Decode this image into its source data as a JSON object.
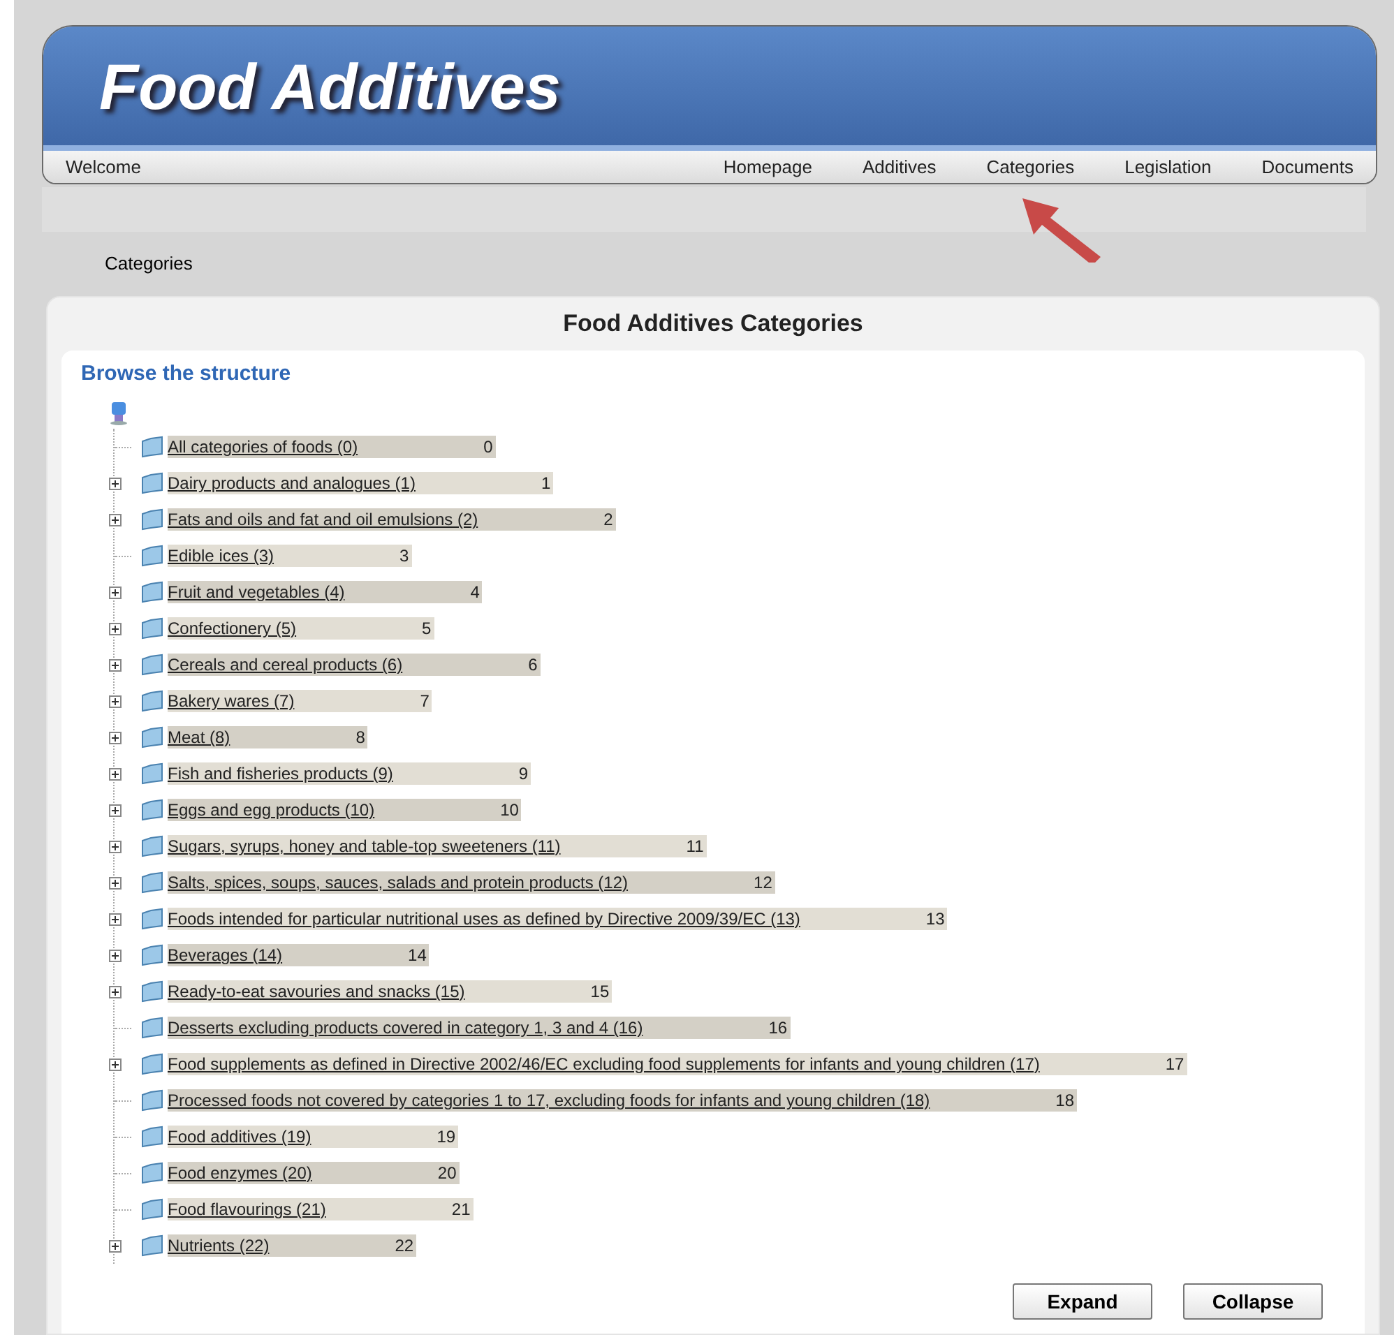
{
  "header": {
    "title": "Food Additives",
    "welcome": "Welcome",
    "nav": [
      {
        "label": "Homepage"
      },
      {
        "label": "Additives"
      },
      {
        "label": "Categories"
      },
      {
        "label": "Legislation"
      },
      {
        "label": "Documents"
      }
    ]
  },
  "breadcrumb": "Categories",
  "panel": {
    "title": "Food Additives Categories",
    "heading": "Browse the structure",
    "tree": [
      {
        "label": "All categories of foods (0)",
        "count": "0",
        "expandable": false
      },
      {
        "label": "Dairy products and analogues (1)",
        "count": "1",
        "expandable": true
      },
      {
        "label": "Fats and oils and fat and oil emulsions (2)",
        "count": "2",
        "expandable": true
      },
      {
        "label": "Edible ices (3)",
        "count": "3",
        "expandable": false
      },
      {
        "label": "Fruit and vegetables (4)",
        "count": "4",
        "expandable": true
      },
      {
        "label": "Confectionery (5)",
        "count": "5",
        "expandable": true
      },
      {
        "label": "Cereals and cereal products (6)",
        "count": "6",
        "expandable": true
      },
      {
        "label": "Bakery wares (7)",
        "count": "7",
        "expandable": true
      },
      {
        "label": "Meat (8)",
        "count": "8",
        "expandable": true
      },
      {
        "label": "Fish and fisheries products (9)",
        "count": "9",
        "expandable": true
      },
      {
        "label": "Eggs and egg products (10)",
        "count": "10",
        "expandable": true
      },
      {
        "label": "Sugars, syrups, honey and table-top sweeteners (11)",
        "count": "11",
        "expandable": true
      },
      {
        "label": "Salts, spices, soups, sauces, salads and protein products (12)",
        "count": "12",
        "expandable": true
      },
      {
        "label": "Foods intended for particular nutritional uses as defined by Directive 2009/39/EC (13)",
        "count": "13",
        "expandable": true
      },
      {
        "label": "Beverages (14)",
        "count": "14",
        "expandable": true
      },
      {
        "label": "Ready-to-eat savouries and snacks (15)",
        "count": "15",
        "expandable": true
      },
      {
        "label": "Desserts excluding products covered in category 1, 3 and 4 (16)",
        "count": "16",
        "expandable": false
      },
      {
        "label": "Food supplements as defined in Directive 2002/46/EC excluding food supplements for infants and young children (17)",
        "count": "17",
        "expandable": true
      },
      {
        "label": "Processed foods not covered by categories 1 to 17, excluding foods for infants and young children (18)",
        "count": "18",
        "expandable": false
      },
      {
        "label": "Food additives (19)",
        "count": "19",
        "expandable": false
      },
      {
        "label": "Food enzymes (20)",
        "count": "20",
        "expandable": false
      },
      {
        "label": "Food flavourings (21)",
        "count": "21",
        "expandable": false
      },
      {
        "label": "Nutrients (22)",
        "count": "22",
        "expandable": true
      }
    ],
    "buttons": [
      {
        "label": "Expand"
      },
      {
        "label": "Collapse"
      }
    ]
  }
}
